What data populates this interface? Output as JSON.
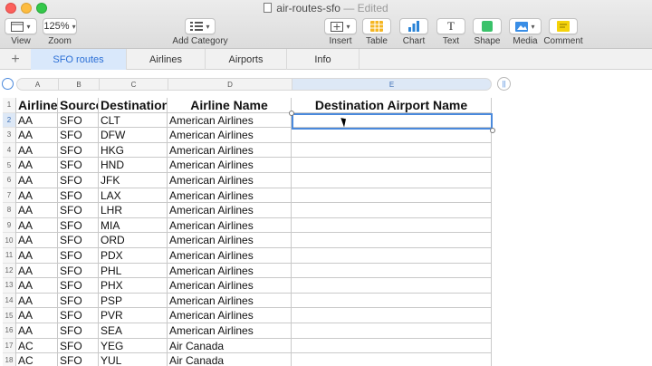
{
  "window": {
    "title": "air-routes-sfo",
    "status": "— Edited"
  },
  "toolbar": {
    "view_label": "View",
    "zoom_value": "125%",
    "zoom_label": "Zoom",
    "add_category_label": "Add Category",
    "insert_label": "Insert",
    "table_label": "Table",
    "chart_label": "Chart",
    "text_label": "Text",
    "shape_label": "Shape",
    "media_label": "Media",
    "comment_label": "Comment",
    "text_button_glyph": "T",
    "colors": {
      "table": "#f5b622",
      "chart": "#2a83d6",
      "shape": "#3ac26a",
      "media": "#3a8ee6",
      "comment": "#f5d30a"
    }
  },
  "sheets": [
    {
      "label": "SFO routes",
      "active": true
    },
    {
      "label": "Airlines",
      "active": false
    },
    {
      "label": "Airports",
      "active": false
    },
    {
      "label": "Info",
      "active": false
    }
  ],
  "columns": [
    "A",
    "B",
    "C",
    "D",
    "E"
  ],
  "table": {
    "header": [
      "Airline",
      "Source",
      "Destination",
      "Airline Name",
      "Destination Airport Name"
    ],
    "rows": [
      [
        "AA",
        "SFO",
        "CLT",
        "American Airlines",
        ""
      ],
      [
        "AA",
        "SFO",
        "DFW",
        "American Airlines",
        ""
      ],
      [
        "AA",
        "SFO",
        "HKG",
        "American Airlines",
        ""
      ],
      [
        "AA",
        "SFO",
        "HND",
        "American Airlines",
        ""
      ],
      [
        "AA",
        "SFO",
        "JFK",
        "American Airlines",
        ""
      ],
      [
        "AA",
        "SFO",
        "LAX",
        "American Airlines",
        ""
      ],
      [
        "AA",
        "SFO",
        "LHR",
        "American Airlines",
        ""
      ],
      [
        "AA",
        "SFO",
        "MIA",
        "American Airlines",
        ""
      ],
      [
        "AA",
        "SFO",
        "ORD",
        "American Airlines",
        ""
      ],
      [
        "AA",
        "SFO",
        "PDX",
        "American Airlines",
        ""
      ],
      [
        "AA",
        "SFO",
        "PHL",
        "American Airlines",
        ""
      ],
      [
        "AA",
        "SFO",
        "PHX",
        "American Airlines",
        ""
      ],
      [
        "AA",
        "SFO",
        "PSP",
        "American Airlines",
        ""
      ],
      [
        "AA",
        "SFO",
        "PVR",
        "American Airlines",
        ""
      ],
      [
        "AA",
        "SFO",
        "SEA",
        "American Airlines",
        ""
      ],
      [
        "AC",
        "SFO",
        "YEG",
        "Air Canada",
        ""
      ],
      [
        "AC",
        "SFO",
        "YUL",
        "Air Canada",
        ""
      ]
    ],
    "row_numbers": [
      "1",
      "2",
      "3",
      "4",
      "5",
      "6",
      "7",
      "8",
      "9",
      "10",
      "11",
      "12",
      "13",
      "14",
      "15",
      "16",
      "17",
      "18"
    ],
    "selected_row": 2,
    "selected_column": "E"
  }
}
